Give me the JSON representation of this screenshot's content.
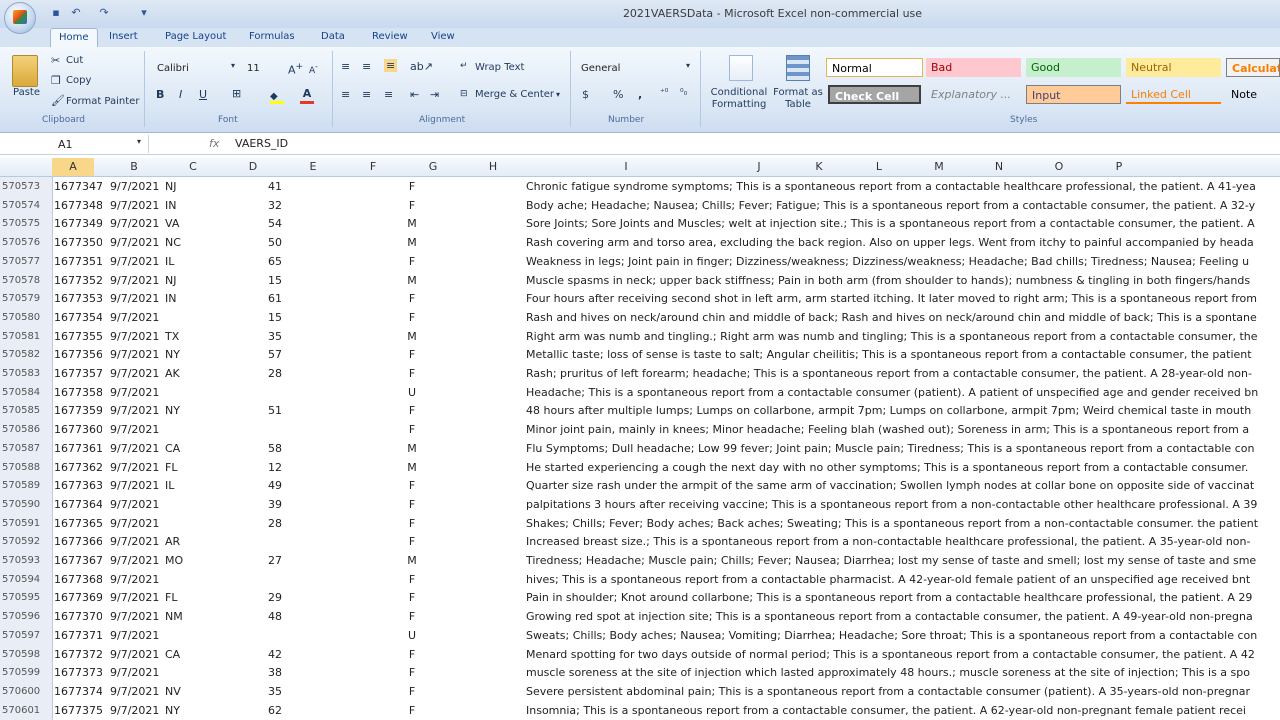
{
  "window": {
    "title": "2021VAERSData - Microsoft Excel non-commercial use"
  },
  "tabs": [
    "Home",
    "Insert",
    "Page Layout",
    "Formulas",
    "Data",
    "Review",
    "View"
  ],
  "ribbon": {
    "clipboard": {
      "paste": "Paste",
      "cut": "Cut",
      "copy": "Copy",
      "format_painter": "Format Painter",
      "label": "Clipboard"
    },
    "font": {
      "name": "Calibri",
      "size": "11",
      "bold": "B",
      "italic": "I",
      "underline": "U",
      "label": "Font"
    },
    "alignment": {
      "wrap_text": "Wrap Text",
      "merge_center": "Merge & Center",
      "label": "Alignment"
    },
    "number": {
      "format": "General",
      "currency": "$",
      "percent": "%",
      "comma": ",",
      "label": "Number"
    },
    "styles": {
      "conditional": "Conditional Formatting",
      "format_table": "Format as Table",
      "normal": "Normal",
      "bad": "Bad",
      "good": "Good",
      "neutral": "Neutral",
      "calculation": "Calculatio",
      "check_cell": "Check Cell",
      "explanatory": "Explanatory ...",
      "input": "Input",
      "linked_cell": "Linked Cell",
      "note": "Note",
      "label": "Styles"
    }
  },
  "formula_bar": {
    "name_box": "A1",
    "fx": "fx",
    "content": "VAERS_ID"
  },
  "columns": [
    "A",
    "B",
    "C",
    "D",
    "E",
    "F",
    "G",
    "H",
    "I",
    "J",
    "K",
    "L",
    "M",
    "N",
    "O",
    "P"
  ],
  "rows": [
    {
      "rn": "570573",
      "id": "1677347",
      "date": "9/7/2021",
      "state": "NJ",
      "age": "41",
      "sex": "F",
      "text": "Chronic fatigue syndrome symptoms; This is a spontaneous report from a contactable healthcare professional, the patient. A 41-yea"
    },
    {
      "rn": "570574",
      "id": "1677348",
      "date": "9/7/2021",
      "state": "IN",
      "age": "32",
      "sex": "F",
      "text": "Body ache; Headache; Nausea; Chills; Fever; Fatigue; This is a spontaneous report from a contactable consumer, the patient. A 32-y"
    },
    {
      "rn": "570575",
      "id": "1677349",
      "date": "9/7/2021",
      "state": "VA",
      "age": "54",
      "sex": "M",
      "text": "Sore Joints; Sore Joints and Muscles; welt at injection site.; This is a spontaneous report from a contactable consumer, the patient. A"
    },
    {
      "rn": "570576",
      "id": "1677350",
      "date": "9/7/2021",
      "state": "NC",
      "age": "50",
      "sex": "M",
      "text": "Rash covering arm and torso area, excluding the back region. Also on upper legs. Went from itchy to painful accompanied by heada"
    },
    {
      "rn": "570577",
      "id": "1677351",
      "date": "9/7/2021",
      "state": "IL",
      "age": "65",
      "sex": "F",
      "text": "Weakness in legs; Joint pain in finger; Dizziness/weakness; Dizziness/weakness; Headache; Bad chills; Tiredness; Nausea; Feeling u"
    },
    {
      "rn": "570578",
      "id": "1677352",
      "date": "9/7/2021",
      "state": "NJ",
      "age": "15",
      "sex": "M",
      "text": "Muscle spasms in neck; upper back stiffness; Pain in both arm (from shoulder to hands); numbness & tingling in both fingers/hands"
    },
    {
      "rn": "570579",
      "id": "1677353",
      "date": "9/7/2021",
      "state": "IN",
      "age": "61",
      "sex": "F",
      "text": "Four hours after receiving second shot in left arm, arm started itching. It later moved to right arm; This is a spontaneous report from"
    },
    {
      "rn": "570580",
      "id": "1677354",
      "date": "9/7/2021",
      "state": "",
      "age": "15",
      "sex": "F",
      "text": "Rash and hives on neck/around chin and middle of back; Rash and hives on neck/around chin and middle of back; This is a spontane"
    },
    {
      "rn": "570581",
      "id": "1677355",
      "date": "9/7/2021",
      "state": "TX",
      "age": "35",
      "sex": "M",
      "text": "Right arm was numb and tingling.; Right arm was numb and tingling; This is a spontaneous report from a contactable consumer, the"
    },
    {
      "rn": "570582",
      "id": "1677356",
      "date": "9/7/2021",
      "state": "NY",
      "age": "57",
      "sex": "F",
      "text": "Metallic taste; loss of sense is taste to salt; Angular cheilitis; This is a spontaneous report from a contactable consumer, the patient"
    },
    {
      "rn": "570583",
      "id": "1677357",
      "date": "9/7/2021",
      "state": "AK",
      "age": "28",
      "sex": "F",
      "text": "Rash; pruritus of left forearm; headache; This is a spontaneous report from a contactable consumer, the patient. A 28-year-old non-"
    },
    {
      "rn": "570584",
      "id": "1677358",
      "date": "9/7/2021",
      "state": "",
      "age": "",
      "sex": "U",
      "text": "Headache; This is a spontaneous report from a contactable consumer (patient). A patient of unspecified age and gender received bn"
    },
    {
      "rn": "570585",
      "id": "1677359",
      "date": "9/7/2021",
      "state": "NY",
      "age": "51",
      "sex": "F",
      "text": "48 hours after multiple lumps; Lumps on collarbone, armpit 7pm; Lumps on collarbone, armpit 7pm; Weird chemical taste in mouth"
    },
    {
      "rn": "570586",
      "id": "1677360",
      "date": "9/7/2021",
      "state": "",
      "age": "",
      "sex": "F",
      "text": "Minor joint pain, mainly in knees; Minor headache; Feeling blah (washed out); Soreness in arm; This is a spontaneous report from a"
    },
    {
      "rn": "570587",
      "id": "1677361",
      "date": "9/7/2021",
      "state": "CA",
      "age": "58",
      "sex": "M",
      "text": "Flu Symptoms; Dull headache; Low 99 fever; Joint pain; Muscle pain; Tiredness; This is a spontaneous report from a contactable con"
    },
    {
      "rn": "570588",
      "id": "1677362",
      "date": "9/7/2021",
      "state": "FL",
      "age": "12",
      "sex": "M",
      "text": "He started experiencing a cough the next day with no other symptoms; This is a spontaneous report from a contactable consumer."
    },
    {
      "rn": "570589",
      "id": "1677363",
      "date": "9/7/2021",
      "state": "IL",
      "age": "49",
      "sex": "F",
      "text": "Quarter size rash under the armpit of the same arm of vaccination; Swollen lymph nodes at collar bone on opposite side of vaccinat"
    },
    {
      "rn": "570590",
      "id": "1677364",
      "date": "9/7/2021",
      "state": "",
      "age": "39",
      "sex": "F",
      "text": "palpitations 3 hours after receiving vaccine; This is a spontaneous report from a non-contactable other healthcare professional. A 39"
    },
    {
      "rn": "570591",
      "id": "1677365",
      "date": "9/7/2021",
      "state": "",
      "age": "28",
      "sex": "F",
      "text": "Shakes; Chills; Fever; Body aches; Back aches; Sweating; This is a spontaneous report from a non-contactable consumer. the patient"
    },
    {
      "rn": "570592",
      "id": "1677366",
      "date": "9/7/2021",
      "state": "AR",
      "age": "",
      "sex": "F",
      "text": "Increased breast size.; This is a spontaneous report from a non-contactable healthcare professional, the patient. A 35-year-old non-"
    },
    {
      "rn": "570593",
      "id": "1677367",
      "date": "9/7/2021",
      "state": "MO",
      "age": "27",
      "sex": "M",
      "text": "Tiredness; Headache; Muscle pain; Chills; Fever; Nausea; Diarrhea; lost my sense of taste and smell; lost my sense of taste and sme"
    },
    {
      "rn": "570594",
      "id": "1677368",
      "date": "9/7/2021",
      "state": "",
      "age": "",
      "sex": "F",
      "text": "hives; This is a spontaneous report from a contactable pharmacist. A 42-year-old female patient of an unspecified age received bnt"
    },
    {
      "rn": "570595",
      "id": "1677369",
      "date": "9/7/2021",
      "state": "FL",
      "age": "29",
      "sex": "F",
      "text": "Pain in shoulder; Knot around collarbone; This is a spontaneous report from a contactable healthcare professional, the patient. A 29"
    },
    {
      "rn": "570596",
      "id": "1677370",
      "date": "9/7/2021",
      "state": "NM",
      "age": "48",
      "sex": "F",
      "text": "Growing red spot at injection site; This is a spontaneous report from a contactable consumer, the patient. A 49-year-old non-pregna"
    },
    {
      "rn": "570597",
      "id": "1677371",
      "date": "9/7/2021",
      "state": "",
      "age": "",
      "sex": "U",
      "text": "Sweats; Chills; Body aches; Nausea; Vomiting; Diarrhea; Headache; Sore throat; This is a spontaneous report from a contactable con"
    },
    {
      "rn": "570598",
      "id": "1677372",
      "date": "9/7/2021",
      "state": "CA",
      "age": "42",
      "sex": "F",
      "text": "Menard spotting for two days outside of normal period; This is a spontaneous report from a contactable consumer, the patient. A 42"
    },
    {
      "rn": "570599",
      "id": "1677373",
      "date": "9/7/2021",
      "state": "",
      "age": "38",
      "sex": "F",
      "text": "muscle soreness at the site of injection which lasted approximately 48 hours.; muscle soreness at the site of injection; This is a spo"
    },
    {
      "rn": "570600",
      "id": "1677374",
      "date": "9/7/2021",
      "state": "NV",
      "age": "35",
      "sex": "F",
      "text": "Severe persistent abdominal pain; This is a spontaneous report from a contactable consumer (patient). A 35-years-old non-pregnar"
    },
    {
      "rn": "570601",
      "id": "1677375",
      "date": "9/7/2021",
      "state": "NY",
      "age": "62",
      "sex": "F",
      "text": "Insomnia; This is a spontaneous report from a contactable consumer, the patient. A 62-year-old non-pregnant female patient recei"
    }
  ]
}
